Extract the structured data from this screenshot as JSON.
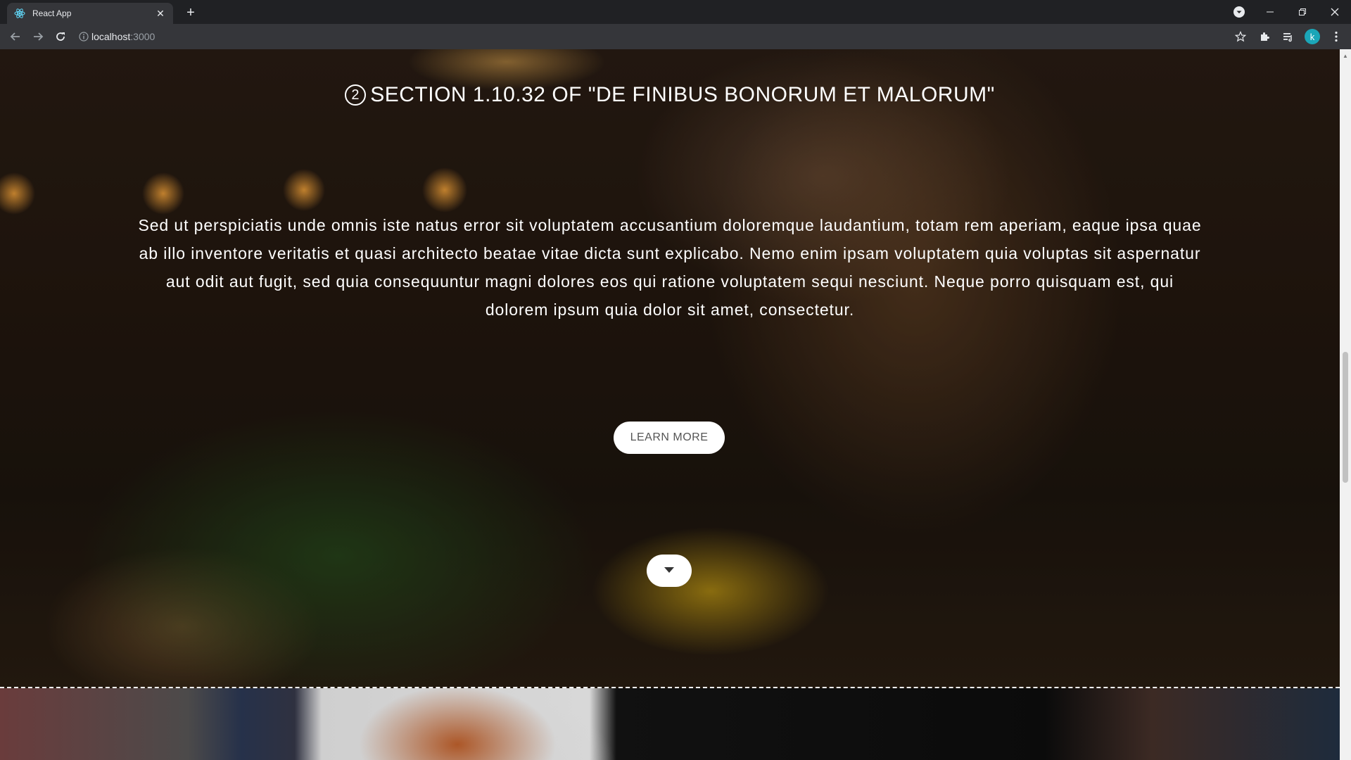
{
  "browser": {
    "tab_title": "React App",
    "url_host": "localhost",
    "url_port": ":3000",
    "profile_initial": "k"
  },
  "hero": {
    "section_number": "2",
    "title": "SECTION 1.10.32 OF \"DE FINIBUS BONORUM ET MALORUM\"",
    "paragraph": "Sed ut perspiciatis unde omnis iste natus error sit voluptatem accusantium doloremque laudantium, totam rem aperiam, eaque ipsa quae ab illo inventore veritatis et quasi architecto beatae vitae dicta sunt explicabo. Nemo enim ipsam voluptatem quia voluptas sit aspernatur aut odit aut fugit, sed quia consequuntur magni dolores eos qui ratione voluptatem sequi nesciunt. Neque porro quisquam est, qui dolorem ipsum quia dolor sit amet, consectetur.",
    "button_label": "LEARN MORE"
  },
  "colors": {
    "chrome_dark": "#202124",
    "chrome_toolbar": "#35363a",
    "avatar": "#1ba6b8",
    "button_bg": "#ffffff"
  },
  "icons": [
    "react-icon",
    "close-icon",
    "plus-icon",
    "media-icon",
    "minimize-icon",
    "restore-icon",
    "window-close-icon",
    "back-icon",
    "forward-icon",
    "reload-icon",
    "info-icon",
    "star-icon",
    "extensions-icon",
    "reading-list-icon",
    "more-icon",
    "chevron-down-icon"
  ]
}
